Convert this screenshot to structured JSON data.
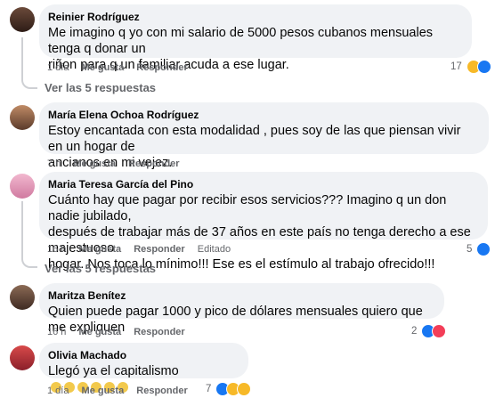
{
  "comments": [
    {
      "author": "Reinier Rodríguez",
      "text_lines": [
        "Me imagino q yo con mi salario de 5000 pesos cubanos mensuales tenga q donar un",
        "riñon para q un familiar acuda a ese lugar."
      ],
      "time": "1 día",
      "like": "Me gusta",
      "reply": "Responder",
      "reaction_count": "17",
      "replies_link": "Ver las 5 respuestas"
    },
    {
      "author": "María Elena Ochoa Rodríguez",
      "text_lines": [
        "Estoy encantada con esta modalidad , pues soy de las que piensan vivir en un hogar de",
        "ancianos en mi vejez."
      ],
      "time": "7 h",
      "like": "Me gusta",
      "reply": "Responder"
    },
    {
      "author": "Maria Teresa García del Pino",
      "text_lines": [
        "Cuánto hay que pagar por recibir esos servicios??? Imagino q un don nadie jubilado,",
        "después de trabajar más de 37 años en este país no tenga derecho a ese majestuoso",
        "hogar. Nos toca lo mínimo!!! Ese es el estímulo al trabajo ofrecido!!!"
      ],
      "time": "16 h",
      "like": "Me gusta",
      "reply": "Responder",
      "edited": "Editado",
      "reaction_count": "5",
      "replies_link": "Ver las 5 respuestas"
    },
    {
      "author": "Maritza Benítez",
      "text_lines": [
        "Quien puede pagar 1000 y pico de dólares mensuales quiero que me expliquen"
      ],
      "time": "16 h",
      "like": "Me gusta",
      "reply": "Responder",
      "reaction_count": "2"
    },
    {
      "author": "Olivia Machado",
      "text_lines": [
        "Llegó ya el capitalismo"
      ],
      "time": "1 día",
      "like": "Me gusta",
      "reply": "Responder",
      "reaction_count": "7"
    }
  ],
  "colors": {
    "bubble": "#f0f2f5",
    "meta": "#65676b",
    "like": "#1877f2",
    "love": "#f33e58",
    "haha": "#f7b928"
  },
  "icons": [
    "like-icon",
    "love-icon",
    "haha-icon",
    "sad-icon"
  ]
}
